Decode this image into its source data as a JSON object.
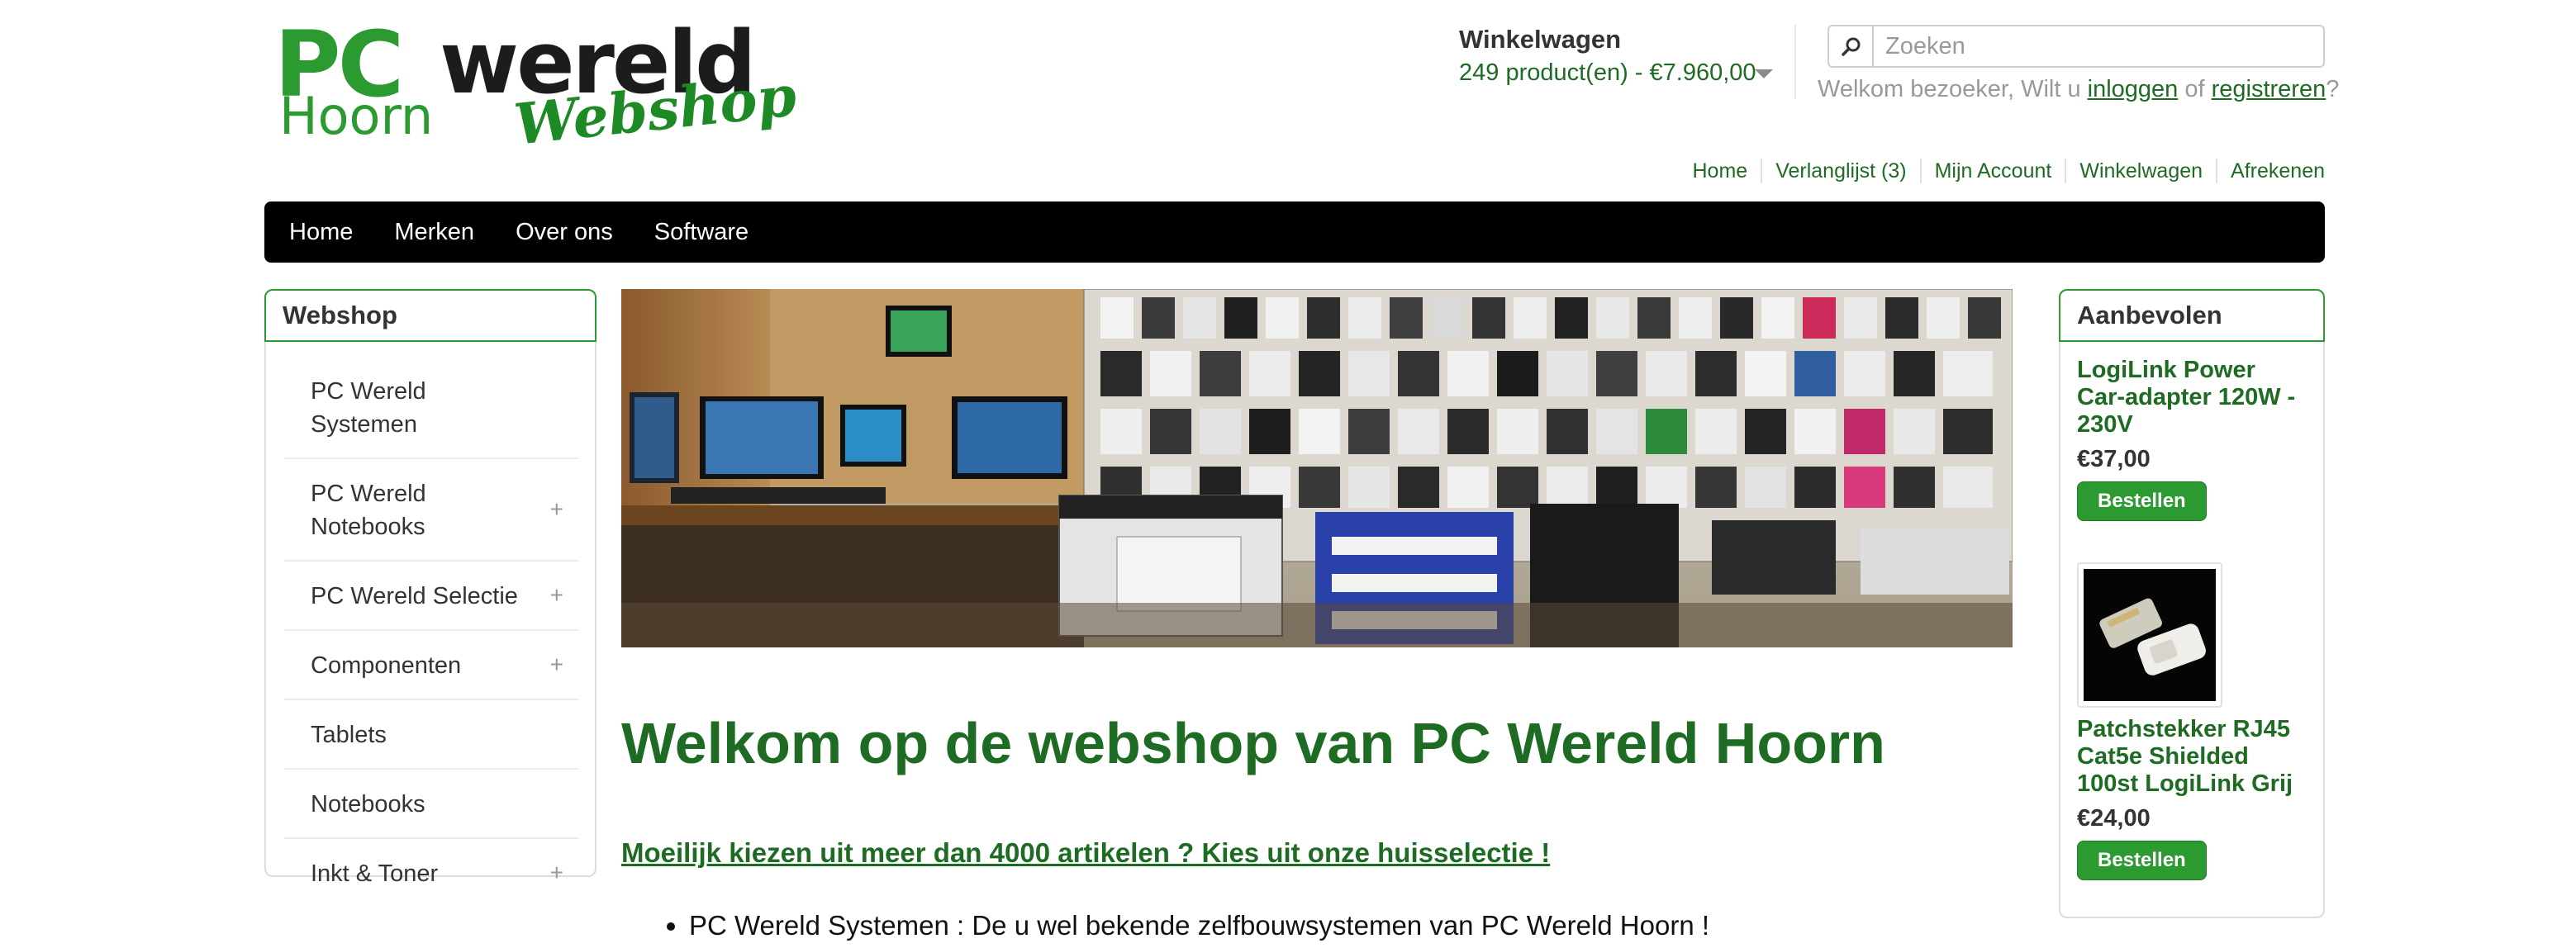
{
  "logo": {
    "line1a": "PC",
    "line1b": "wereld",
    "line2a": "Hoorn",
    "line2b": "Webshop"
  },
  "cart": {
    "title": "Winkelwagen",
    "summary": "249 product(en) - €7.960,00"
  },
  "search": {
    "placeholder": "Zoeken"
  },
  "welcome": {
    "prefix": "Welkom bezoeker, Wilt u",
    "login": "inloggen",
    "middle": "of",
    "register": "registreren",
    "suffix": "?"
  },
  "top_links": [
    "Home",
    "Verlanglijst (3)",
    "Mijn Account",
    "Winkelwagen",
    "Afrekenen"
  ],
  "main_nav": [
    "Home",
    "Merken",
    "Over ons",
    "Software"
  ],
  "sidebar": {
    "title": "Webshop",
    "items": [
      {
        "label": "PC Wereld Systemen",
        "expandable": false
      },
      {
        "label": "PC Wereld Notebooks",
        "expandable": true
      },
      {
        "label": "PC Wereld Selectie",
        "expandable": true
      },
      {
        "label": "Componenten",
        "expandable": true
      },
      {
        "label": "Tablets",
        "expandable": false
      },
      {
        "label": "Notebooks",
        "expandable": false
      },
      {
        "label": "Inkt & Toner",
        "expandable": true
      }
    ],
    "plus_symbol": "+"
  },
  "featured": {
    "title": "Aanbevolen",
    "products": [
      {
        "name": "LogiLink Power Car-adapter 120W - 230V",
        "price": "€37,00",
        "button": "Bestellen"
      },
      {
        "name": "Patchstekker RJ45 Cat5e Shielded 100st LogiLink Grij",
        "price": "€24,00",
        "button": "Bestellen"
      }
    ]
  },
  "content": {
    "heading": "Welkom op de webshop van PC Wereld Hoorn",
    "subheading": "Moeilijk kiezen uit meer dan 4000 artikelen ? Kies uit onze huisselectie !",
    "bullets": [
      "PC Wereld Systemen : De u wel bekende zelfbouwsystemen van PC Wereld Hoorn !"
    ]
  },
  "colors": {
    "brand_green": "#2a9a31",
    "link_green": "#1e6b23",
    "nav_bg": "#000000"
  },
  "icons": {
    "search": "magnifier-icon",
    "cart_dropdown": "caret-down-icon"
  }
}
